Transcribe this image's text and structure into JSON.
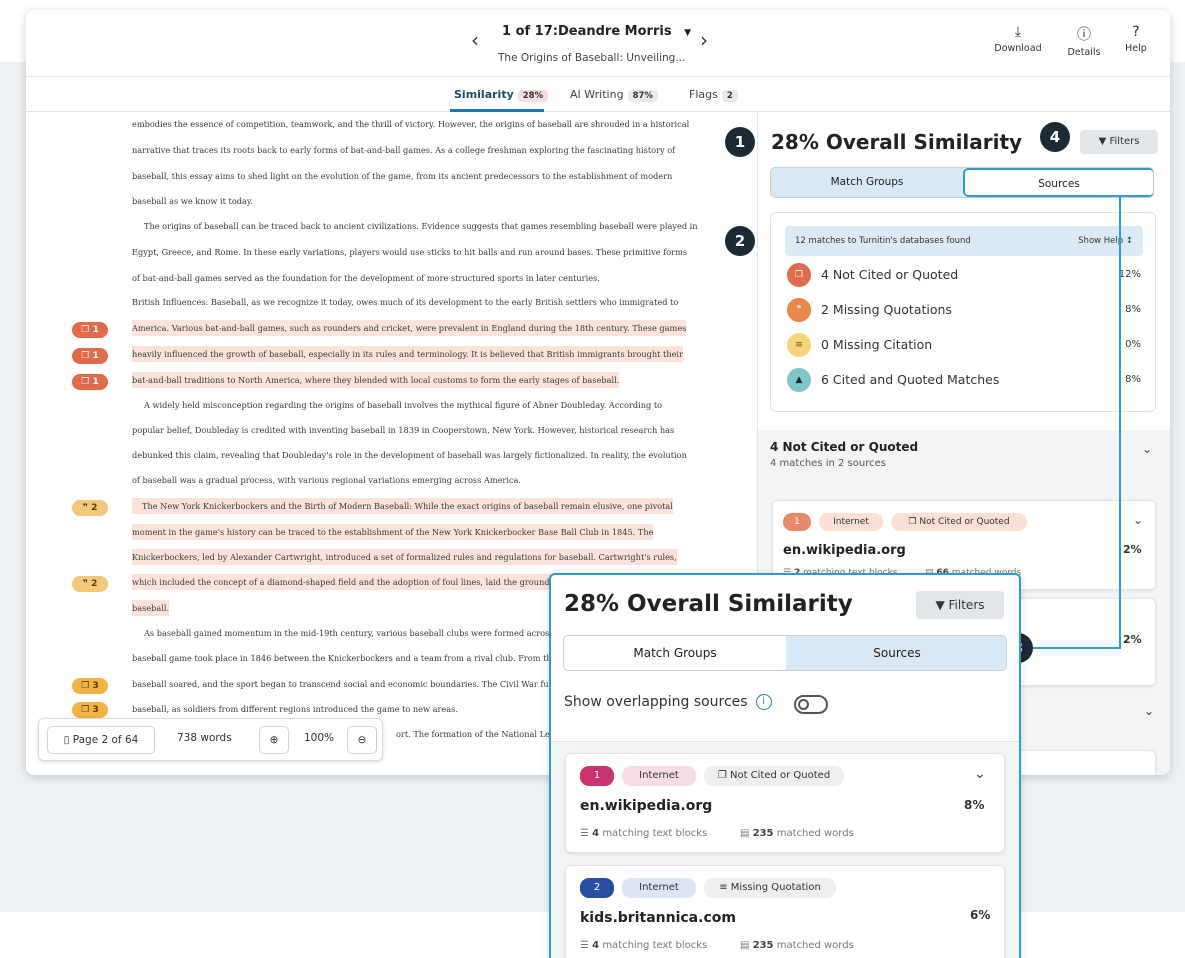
{
  "header": {
    "title": "1 of 17:Deandre Morris",
    "subtitle": "The Origins of Baseball: Unveiling...",
    "tools": [
      {
        "label": "Download",
        "icon": "download-icon"
      },
      {
        "label": "Details",
        "icon": "info-icon"
      },
      {
        "label": "Help",
        "icon": "help-icon"
      }
    ]
  },
  "tabs": [
    {
      "label": "Similarity",
      "count": "28%"
    },
    {
      "label": "AI Writing",
      "count": "87%"
    },
    {
      "label": "Flags",
      "count": "2"
    }
  ],
  "document": {
    "lines": [
      "embodies the essence of competition, teamwork, and the thrill of victory. However, the origins of baseball are shrouded in a historical",
      "narrative that traces its roots back to early forms of bat-and-ball games. As a college freshman exploring the fascinating history of",
      "baseball, this essay aims to shed light on the evolution of the game, from its ancient predecessors to the establishment of modern",
      "baseball as we know it today.",
      "The origins of baseball can be traced back to ancient civilizations. Evidence suggests that games resembling baseball were played in",
      "Egypt, Greece, and Rome. In these early variations, players would use sticks to hit balls and run around bases. These primitive forms",
      "of bat-and-ball games served as the foundation for the development of more structured sports in later centuries.",
      "British Influences: Baseball, as we recognize it today, owes much of its development to the early British settlers who immigrated to",
      "America. Various bat-and-ball games, such as rounders and cricket, were prevalent in England during the 18th century. These games",
      "heavily influenced the growth of baseball, especially in its rules and terminology. It is believed that British immigrants brought their",
      "bat-and-ball traditions to North America, where they blended with local customs to form the early stages of baseball.",
      "A widely held misconception regarding the origins of baseball involves the mythical figure of Abner Doubleday. According to",
      "popular belief, Doubleday is credited with inventing baseball in 1839 in Cooperstown, New York. However, historical research has",
      "debunked this claim, revealing that Doubleday's role in the development of baseball was largely fictionalized. In reality, the evolution",
      "of baseball was a gradual process, with various regional variations emerging across America.",
      "The New York Knickerbockers and the Birth of Modern Baseball: While the exact origins of baseball remain elusive, one pivotal",
      "moment in the game's history can be traced to the establishment of the New York Knickerbocker Base Ball Club in 1845. The",
      "Knickerbockers, led by Alexander Cartwright, introduced a set of formalized rules and regulations for baseball. Cartwright's rules,",
      "which included the concept of a diamond-shaped field and the adoption of foul lines, laid the groundwork fo",
      "baseball.",
      "As baseball gained momentum in the mid-19th century, various baseball clubs were formed across Ameri",
      "baseball game took place in 1846 between the Knickerbockers and a team from a rival club. From that poin",
      "baseball soared, and the sport began to transcend social and economic boundaries. The Civil War further co",
      "baseball, as soldiers from different regions introduced the game to new areas.",
      "ort. The formation of the National League"
    ],
    "markers": [
      "1",
      "1",
      "1",
      "2",
      "2",
      "3",
      "3"
    ]
  },
  "pagebar": {
    "page": "Page 2 of 64",
    "words": "738 words",
    "zoom": "100%"
  },
  "panel": {
    "title": "28% Overall Similarity",
    "filters": "Filters",
    "seg_a": "Match Groups",
    "seg_b": "Sources",
    "summary_head": "12 matches to Turnitin's databases found",
    "show_help": "Show Help",
    "rows": [
      {
        "label": "4  Not Cited or Quoted",
        "pct": "12%",
        "color": "#e36b4d"
      },
      {
        "label": "2  Missing Quotations",
        "pct": "8%",
        "color": "#e8884a"
      },
      {
        "label": "0  Missing Citation",
        "pct": "0%",
        "color": "#f5d47a"
      },
      {
        "label": "6  Cited and Quoted Matches",
        "pct": "8%",
        "color": "#7fc6c9"
      }
    ],
    "group_title": "4  Not Cited or Quoted",
    "group_sub": "4 matches in 2 sources",
    "card1": {
      "num": "1",
      "type": "Internet",
      "tag": "Not Cited or Quoted",
      "name": "en.wikipedia.org",
      "pct": "2%",
      "blocks": "2",
      "blocks_label": "matching text blocks",
      "words": "66",
      "words_label": "matched words"
    },
    "card2_pct": "2%"
  },
  "callouts": [
    "1",
    "2",
    "3",
    "4"
  ],
  "zoom": {
    "title": "28% Overall Similarity",
    "filters": "Filters",
    "seg_a": "Match Groups",
    "seg_b": "Sources",
    "overlap": "Show overlapping sources",
    "sources": [
      {
        "num": "1",
        "num_color": "#c8336d",
        "type": "Internet",
        "type_bg": "#f8dde6",
        "tag": "Not Cited or Quoted",
        "name": "en.wikipedia.org",
        "pct": "8%",
        "blocks": "4",
        "blocks_label": "matching text blocks",
        "words": "235",
        "words_label": "matched words"
      },
      {
        "num": "2",
        "num_color": "#2a4fa0",
        "type": "Internet",
        "type_bg": "#dde5f5",
        "tag": "Missing Quotation",
        "name": "kids.britannica.com",
        "pct": "6%",
        "blocks": "4",
        "blocks_label": "matching text blocks",
        "words": "235",
        "words_label": "matched words"
      }
    ]
  },
  "colors": {
    "accent": "#2e9ad6",
    "highlight": "#fbe3dc",
    "callout": "#1c2b33"
  }
}
